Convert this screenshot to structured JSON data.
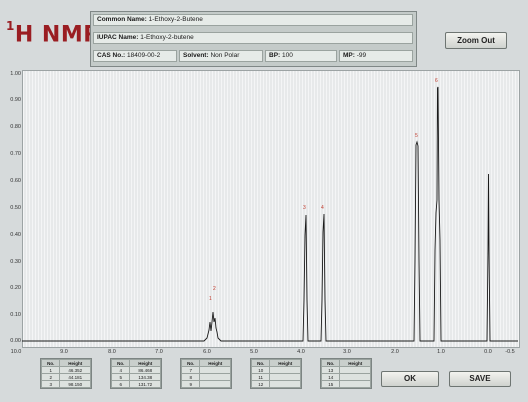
{
  "app": {
    "title_superscript": "1",
    "title_main": "H NMR"
  },
  "compound": {
    "common_name_label": "Common Name:",
    "common_name": "1-Ethoxy-2-Butene",
    "iupac_label": "IUPAC Name:",
    "iupac_name": "1-Ethoxy-2-butene",
    "cas_label": "CAS No.:",
    "cas": "18409-00-2",
    "solvent_label": "Solvent:",
    "solvent": "Non Polar",
    "bp_label": "BP:",
    "bp": "100",
    "mp_label": "MP:",
    "mp": "-99"
  },
  "buttons": {
    "zoom_out": "Zoom Out",
    "ok": "OK",
    "save": "SAVE"
  },
  "axes": {
    "y_ticks": [
      "1.00",
      "0.90",
      "0.80",
      "0.70",
      "0.60",
      "0.50",
      "0.40",
      "0.30",
      "0.20",
      "0.10",
      "0.00"
    ],
    "x_ticks": [
      "10.0",
      "9.0",
      "8.0",
      "7.0",
      "6.0",
      "5.0",
      "4.0",
      "3.0",
      "2.0",
      "1.0",
      "0.0",
      "-0.5"
    ]
  },
  "peaks": {
    "labels": [
      "1",
      "2",
      "3",
      "4",
      "5",
      "6"
    ]
  },
  "peak_tables": [
    {
      "headers": [
        "No.",
        "Height"
      ],
      "rows": [
        [
          "1",
          "46.352"
        ],
        [
          "2",
          "44.181"
        ],
        [
          "3",
          "98.150"
        ]
      ]
    },
    {
      "headers": [
        "No.",
        "Height"
      ],
      "rows": [
        [
          "4",
          "86.468"
        ],
        [
          "5",
          "134.38"
        ],
        [
          "6",
          "131.72"
        ]
      ]
    },
    {
      "headers": [
        "No.",
        "Height"
      ],
      "rows": [
        [
          "7",
          ""
        ],
        [
          "8",
          ""
        ],
        [
          "9",
          ""
        ]
      ]
    },
    {
      "headers": [
        "No.",
        "Height"
      ],
      "rows": [
        [
          "10",
          ""
        ],
        [
          "11",
          ""
        ],
        [
          "12",
          ""
        ]
      ]
    },
    {
      "headers": [
        "No.",
        "Height"
      ],
      "rows": [
        [
          "13",
          ""
        ],
        [
          "14",
          ""
        ],
        [
          "15",
          ""
        ]
      ]
    }
  ],
  "colors": {
    "title": "#9a1d22",
    "peak_label": "#c0392b",
    "trace": "#1a1a1a"
  }
}
